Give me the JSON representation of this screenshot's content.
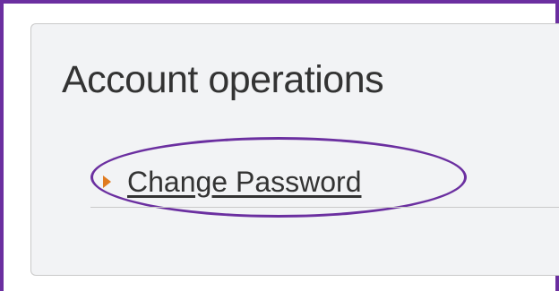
{
  "panel": {
    "title": "Account operations",
    "links": [
      {
        "label": "Change Password",
        "icon": "arrow-right-icon"
      }
    ]
  },
  "colors": {
    "highlight": "#6b2fa0",
    "arrow": "#e07b20",
    "panel_bg": "#f2f3f5",
    "text": "#333333"
  }
}
